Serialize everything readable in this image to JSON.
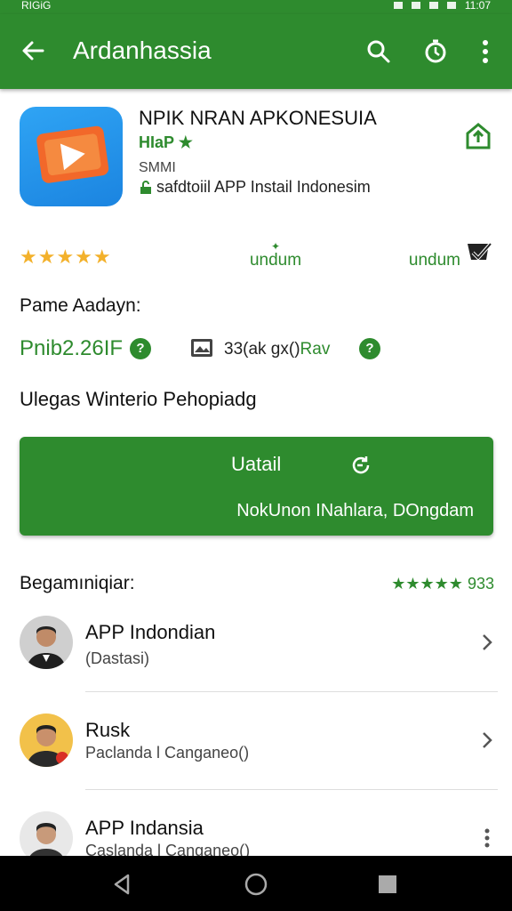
{
  "status_bar": {
    "left_text": "RIGiG",
    "time": "11:07"
  },
  "app_bar": {
    "title": "Ardanhassia",
    "icons": [
      "back-arrow-icon",
      "search-icon",
      "history-icon",
      "more-vert-icon"
    ]
  },
  "app": {
    "name": "NPIK NRAN APKONESUIA",
    "developer": "HIaP",
    "small_label": "SMMI",
    "subtitle": "safdtoiil APP Instail Indonesim",
    "brand_colors": {
      "primary": "#2e8b2e",
      "icon_blue": "#1b84e0",
      "icon_orange": "#f2682a",
      "star": "#f3b12b"
    }
  },
  "stats": {
    "stars": "★★★★★",
    "left_label": "undum",
    "right_label": "undum"
  },
  "details": {
    "section_title": "Pame Aadayn:",
    "price": "Pnib2.26IF",
    "price_info_glyph": "?",
    "size": "33(ak gx()",
    "size_suffix": "Rav",
    "size_info_glyph": "?"
  },
  "updates_title": "Ulegas Winterio Pehopiadg",
  "install_button": {
    "label": "Uatail",
    "sub_label": "NokUnon INahlara, DOngdam"
  },
  "reviews": {
    "title": "Begamıniqiar:",
    "stars": "★★★★★",
    "score": "933",
    "items": [
      {
        "name": "APP Indondian",
        "sub": "(Dastasi)"
      },
      {
        "name": "Rusk",
        "sub": "Paclanda l Canganeo()"
      },
      {
        "name": "APP Indansia",
        "sub": "Caslanda l Canganeo()"
      }
    ]
  }
}
